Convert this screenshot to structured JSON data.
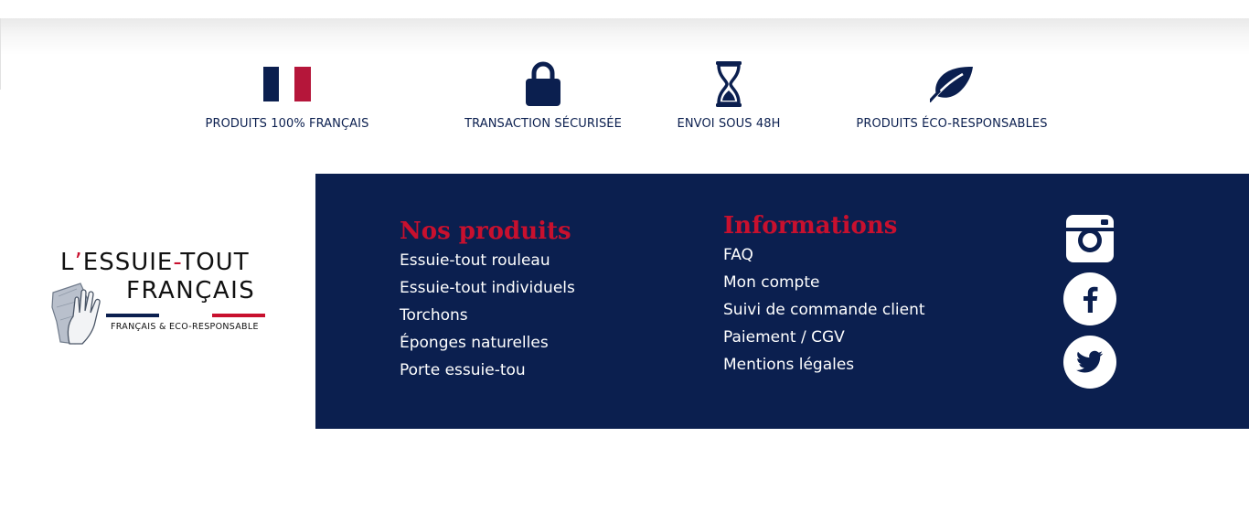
{
  "features": [
    {
      "icon": "french-flag-icon",
      "label": "PRODUITS 100% FRANÇAIS"
    },
    {
      "icon": "padlock-icon",
      "label": "TRANSACTION SÉCURISÉE"
    },
    {
      "icon": "hourglass-icon",
      "label": "ENVOI SOUS 48H"
    },
    {
      "icon": "leaf-icon",
      "label": "PRODUITS ÉCO-RESPONSABLES"
    }
  ],
  "logo": {
    "line1_prefix": "L",
    "line1_apostrophe": "’",
    "line1_word1": "ESSUIE",
    "line1_dash": "-",
    "line1_word2": "TOUT",
    "line2": "FRANÇAIS",
    "tagline": "FRANÇAIS & ECO-RESPONSABLE"
  },
  "footer": {
    "products": {
      "title": "Nos produits",
      "links": [
        "Essuie-tout rouleau",
        "Essuie-tout individuels",
        "Torchons",
        "Éponges naturelles",
        "Porte essuie-tou"
      ]
    },
    "info": {
      "title": "Informations",
      "links": [
        "FAQ",
        "Mon compte",
        "Suivi de commande client",
        "Paiement / CGV",
        "Mentions légales"
      ]
    },
    "social": [
      "instagram-icon",
      "facebook-icon",
      "twitter-icon"
    ]
  },
  "colors": {
    "navy": "#0b1f4f",
    "red": "#c8102e",
    "white": "#ffffff",
    "flag_blue": "#0b1f4f",
    "flag_red": "#b5163a"
  }
}
